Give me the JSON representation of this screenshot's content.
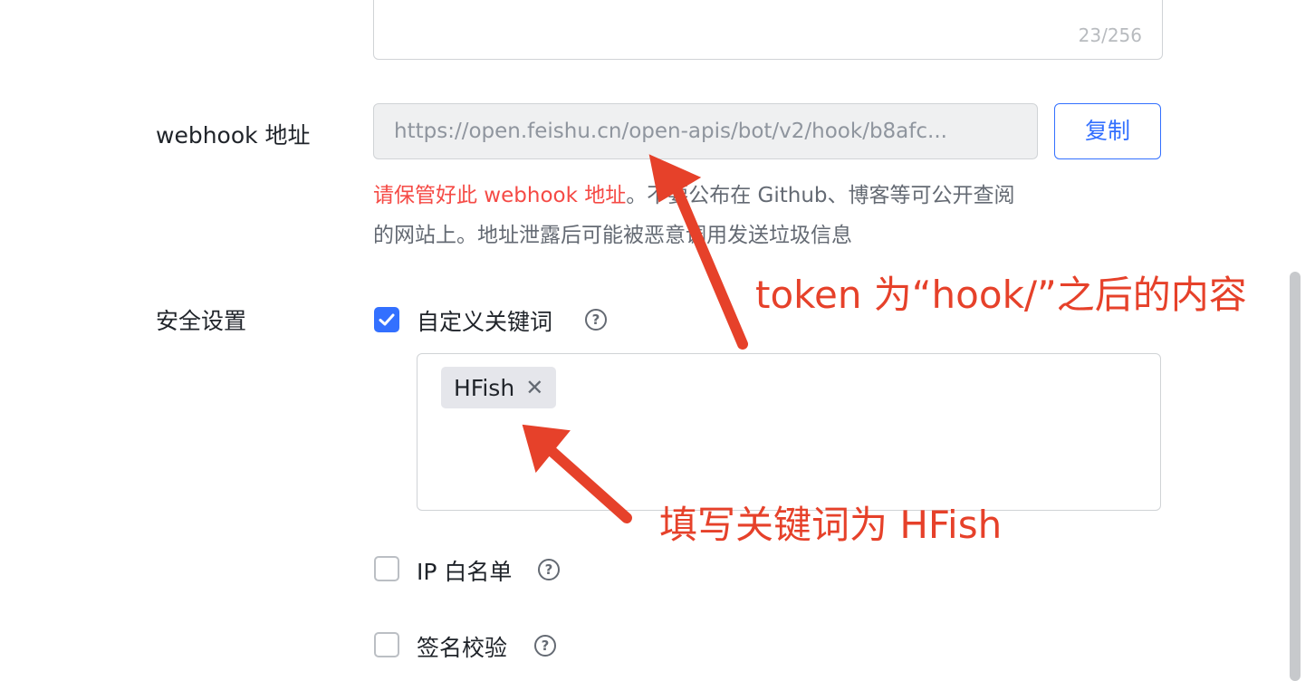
{
  "top_field": {
    "counter": "23/256"
  },
  "webhook": {
    "label": "webhook 地址",
    "value": "https://open.feishu.cn/open-apis/bot/v2/hook/b8afc...",
    "copy_label": "复制",
    "warning_red": "请保管好此 webhook 地址",
    "warning_rest_line1": "。不要公布在 Github、博客等可公开查阅",
    "warning_line2": "的网站上。地址泄露后可能被恶意调用发送垃圾信息"
  },
  "security": {
    "label": "安全设置",
    "keyword": {
      "label": "自定义关键词",
      "checked": true,
      "tags": [
        "HFish"
      ]
    },
    "ip_whitelist": {
      "label": "IP 白名单",
      "checked": false
    },
    "signature": {
      "label": "签名校验",
      "checked": false
    }
  },
  "annotations": {
    "token_note": "token 为“hook/”之后的内容",
    "keyword_note": "填写关键词为 HFish"
  },
  "colors": {
    "accent": "#3370ff",
    "warning": "#f54a45",
    "annotation": "#e6412a"
  }
}
